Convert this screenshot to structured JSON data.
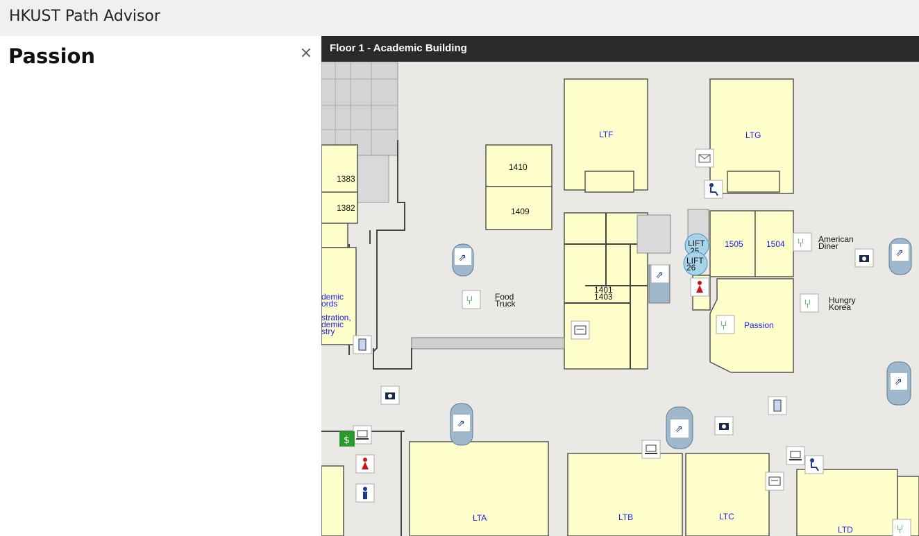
{
  "app": {
    "title": "HKUST Path Advisor"
  },
  "panel": {
    "title": "Passion",
    "close_glyph": "×"
  },
  "map": {
    "header": "Floor 1 - Academic Building",
    "rooms": {
      "ltf": "LTF",
      "ltg": "LTG",
      "r1410": "1410",
      "r1409": "1409",
      "r1383": "1383",
      "r1382": "1382",
      "r1505": "1505",
      "r1504": "1504",
      "r1401": "1401",
      "r1403": "1403",
      "passion": "Passion",
      "lta": "LTA",
      "ltb": "LTB",
      "ltc": "LTC",
      "ltd": "LTD"
    },
    "labels": {
      "lift25_a": "LIFT",
      "lift25_b": "25",
      "lift26_a": "LIFT",
      "lift26_b": "26",
      "american_a": "American",
      "american_b": "Diner",
      "hungry_a": "Hungry",
      "hungry_b": "Korea",
      "food_a": "Food",
      "food_b": "Truck",
      "acad_rec_a": "demic",
      "acad_rec_b": "ords",
      "admin_a": "stration,",
      "admin_b": "demic",
      "admin_c": "stry"
    },
    "icons": [
      "restaurant-icon",
      "escalator-icon",
      "toilet-female-icon",
      "toilet-male-icon",
      "camera-icon",
      "atm-icon",
      "laptop-icon",
      "mail-icon",
      "accessible-toilet-icon",
      "printer-icon",
      "kiosk-icon",
      "lift-icon"
    ]
  }
}
